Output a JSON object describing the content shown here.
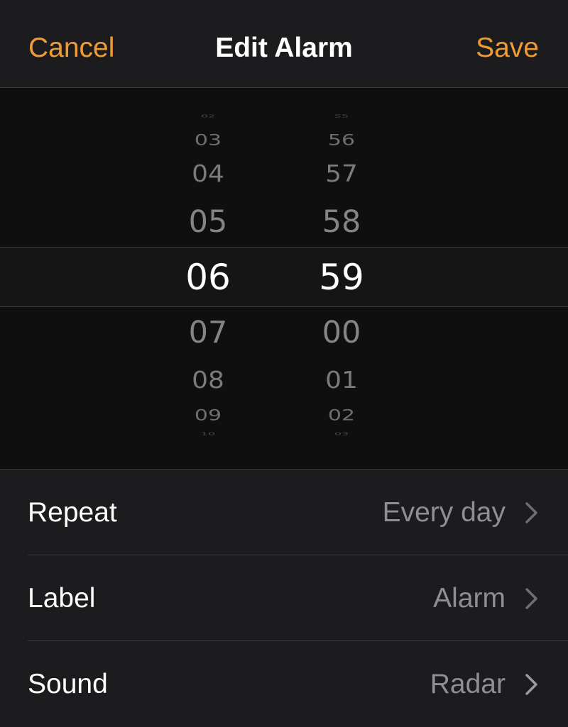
{
  "nav": {
    "cancel_label": "Cancel",
    "title": "Edit Alarm",
    "save_label": "Save"
  },
  "picker": {
    "hours": [
      "02",
      "03",
      "04",
      "05",
      "06",
      "07",
      "08",
      "09",
      "10"
    ],
    "minutes": [
      "55",
      "56",
      "57",
      "58",
      "59",
      "00",
      "01",
      "02",
      "03"
    ],
    "selected_hour": "06",
    "selected_minute": "59"
  },
  "settings": [
    {
      "label": "Repeat",
      "value": "Every day"
    },
    {
      "label": "Label",
      "value": "Alarm"
    },
    {
      "label": "Sound",
      "value": "Radar"
    }
  ],
  "colors": {
    "accent": "#f09a36",
    "background": "#1c1c1e",
    "picker_background": "#0f0f10",
    "secondary_text": "#8e8e93"
  },
  "icons": {
    "row_chevron": "chevron-right-icon"
  }
}
